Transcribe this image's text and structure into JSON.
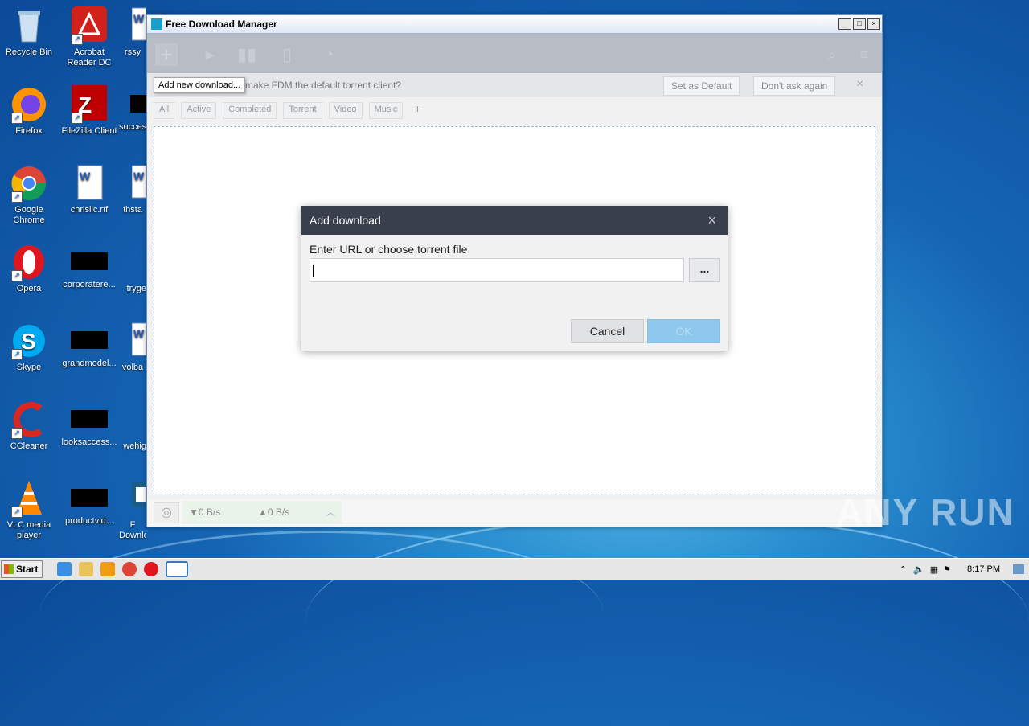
{
  "desktop": {
    "icons": [
      {
        "label": "Recycle Bin"
      },
      {
        "label": "Acrobat Reader DC"
      },
      {
        "label": "rssy"
      },
      {
        "label": "Firefox"
      },
      {
        "label": "FileZilla Client"
      },
      {
        "label": "succes"
      },
      {
        "label": "Google Chrome"
      },
      {
        "label": "chrisllc.rtf"
      },
      {
        "label": "thsta"
      },
      {
        "label": "Opera"
      },
      {
        "label": "corporatere..."
      },
      {
        "label": "tryge"
      },
      {
        "label": "Skype"
      },
      {
        "label": "grandmodel..."
      },
      {
        "label": "volba"
      },
      {
        "label": "CCleaner"
      },
      {
        "label": "looksaccess..."
      },
      {
        "label": "wehig"
      },
      {
        "label": "VLC media player"
      },
      {
        "label": "productvid..."
      },
      {
        "label": "F Downlo..."
      }
    ]
  },
  "window": {
    "title": "Free Download Manager",
    "tooltip": "Add new download...",
    "notification": {
      "text": "make FDM the default torrent client?",
      "set_default": "Set as Default",
      "dont_ask": "Don't ask again",
      "close": "×"
    },
    "tabs": [
      "All",
      "Active",
      "Completed",
      "Torrent",
      "Video",
      "Music",
      "+"
    ],
    "status": {
      "down": "▼0 B/s",
      "up": "▲0 B/s"
    }
  },
  "dialog": {
    "title": "Add download",
    "close": "×",
    "label": "Enter URL or choose torrent file",
    "input_value": "",
    "browse": "...",
    "cancel": "Cancel",
    "ok": "OK"
  },
  "taskbar": {
    "start": "Start",
    "clock": "8:17 PM"
  },
  "watermark": "ANY RUN"
}
